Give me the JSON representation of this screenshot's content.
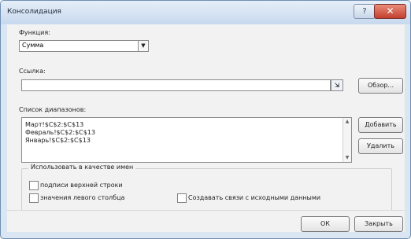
{
  "window": {
    "title": "Консолидация",
    "help_glyph": "?",
    "close_glyph": "✕"
  },
  "function_section": {
    "label": "Функция:",
    "selected": "Сумма",
    "arrow_glyph": "▼"
  },
  "reference_section": {
    "label": "Ссылка:",
    "value": "",
    "collapse_glyph": "⇲",
    "browse_label": "Обзор..."
  },
  "ranges_section": {
    "label": "Список диапазонов:",
    "items": [
      "Март!$C$2:$C$13",
      "Февраль!$C$2:$C$13",
      "Январь!$C$2:$C$13"
    ],
    "add_label": "Добавить",
    "delete_label": "Удалить",
    "scroll_up": "▲",
    "scroll_down": "▼"
  },
  "use_labels": {
    "title": "Использовать в качестве имен",
    "top_row": "подписи верхней строки",
    "left_column": "значения левого столбца",
    "create_links": "Создавать связи с исходными данными"
  },
  "footer": {
    "ok_label": "ОК",
    "close_label": "Закрыть"
  }
}
